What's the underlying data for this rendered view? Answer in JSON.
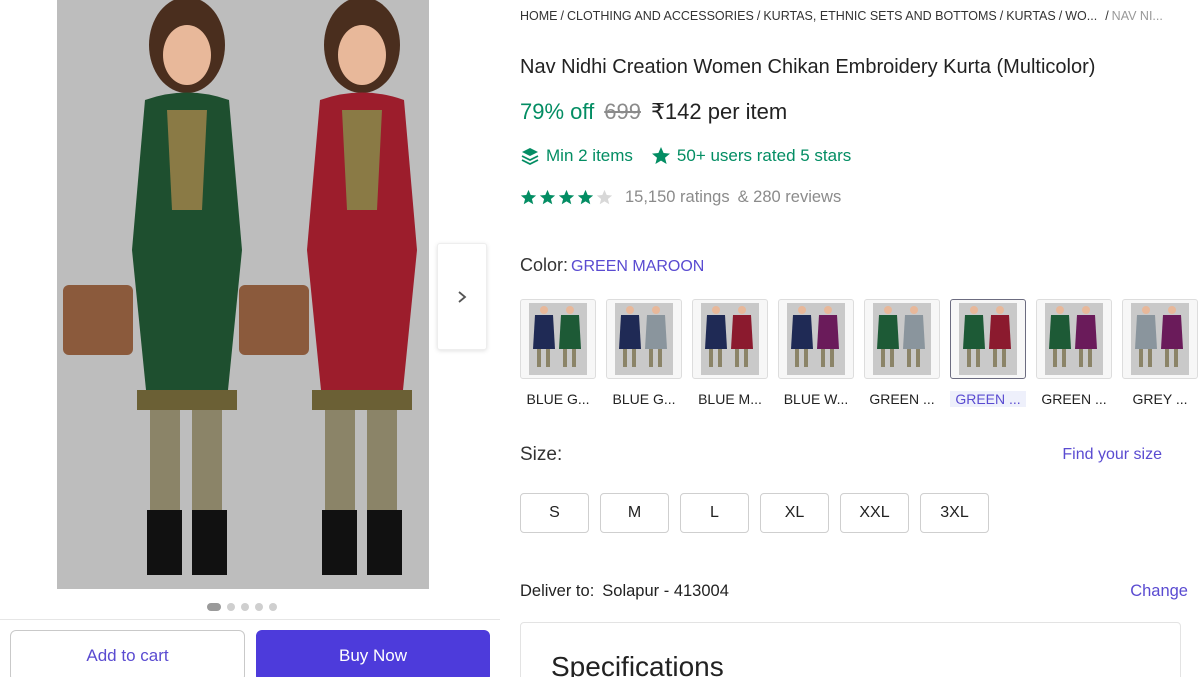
{
  "breadcrumb": {
    "items": [
      "HOME",
      "CLOTHING AND ACCESSORIES",
      "KURTAS, ETHNIC SETS AND BOTTOMS",
      "KURTAS",
      "WO..."
    ],
    "last": "NAV NI..."
  },
  "product": {
    "title": "Nav Nidhi Creation Women Chikan Embroidery Kurta (Multicolor)",
    "discount": "79% off",
    "mrp": "699",
    "price": "₹142 per item",
    "min_items": "Min 2 items",
    "users_rated": "50+ users rated 5 stars",
    "rating_value": 4,
    "ratings_count": "15,150 ratings",
    "reviews_count": "& 280 reviews"
  },
  "color": {
    "label": "Color:",
    "selected": "GREEN MAROON",
    "swatches": [
      {
        "label": "BLUE G...",
        "colors": [
          "#1f2a55",
          "#1d5a36"
        ]
      },
      {
        "label": "BLUE G...",
        "colors": [
          "#1f2a55",
          "#8a959d"
        ]
      },
      {
        "label": "BLUE M...",
        "colors": [
          "#1f2a55",
          "#8b1a2e"
        ]
      },
      {
        "label": "BLUE W...",
        "colors": [
          "#1f2a55",
          "#6a1b5a"
        ]
      },
      {
        "label": "GREEN ...",
        "colors": [
          "#1d5a36",
          "#8a959d"
        ]
      },
      {
        "label": "GREEN ...",
        "colors": [
          "#1d5a36",
          "#8b1a2e"
        ],
        "selected": true
      },
      {
        "label": "GREEN ...",
        "colors": [
          "#1d5a36",
          "#6a1b5a"
        ]
      },
      {
        "label": "GREY ...",
        "colors": [
          "#8a959d",
          "#6a1b5a"
        ]
      }
    ]
  },
  "size": {
    "label": "Size:",
    "find_link": "Find your size",
    "options": [
      "S",
      "M",
      "L",
      "XL",
      "XXL",
      "3XL"
    ]
  },
  "delivery": {
    "label": "Deliver to:",
    "location": "Solapur - 413004",
    "change": "Change"
  },
  "specifications": {
    "title": "Specifications"
  },
  "actions": {
    "add_to_cart": "Add to cart",
    "buy_now": "Buy Now"
  },
  "gallery": {
    "dot_count": 5,
    "active_dot": 0
  },
  "colors": {
    "accent": "#5a4bd1",
    "buy_button": "#4d3bdb",
    "green": "#038d63",
    "star": "#038d63"
  }
}
